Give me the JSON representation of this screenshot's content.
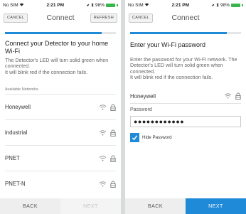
{
  "left": {
    "status": {
      "carrier": "No SIM",
      "time": "2:21 PM",
      "battery": "98%"
    },
    "nav": {
      "cancel": "CANCEL",
      "title": "Connect",
      "refresh": "REFRESH"
    },
    "progress_fraction": 0.87,
    "heading": "Connect your Detector to your home Wi-Fi",
    "body": "The Detector's LED will turn solid green when connected.\nIt will blink red if the connection fails.",
    "section_label": "Available Networks",
    "networks": [
      {
        "name": "Honeywell"
      },
      {
        "name": "industrial"
      },
      {
        "name": "PNET"
      },
      {
        "name": "PNET-N"
      }
    ],
    "back": "BACK",
    "next": "NEXT"
  },
  "right": {
    "status": {
      "carrier": "No SIM",
      "time": "2:21 PM",
      "battery": "98%"
    },
    "nav": {
      "cancel": "CANCEL",
      "title": "Connect"
    },
    "progress_fraction": 0.87,
    "heading": "Enter your Wi-Fi password",
    "body": "Enter the password for your Wi-Fi network. The Detector's LED will turn solid green when connected.\nIt will blink red if the connection fails.",
    "network_name": "Honeywell",
    "password_label": "Password",
    "password_value": "●●●●●●●●●●●●",
    "hide_password_label": "Hide Password",
    "hide_password_checked": true,
    "back": "BACK",
    "next": "NEXT"
  },
  "colors": {
    "accent": "#1f8ad8",
    "battery": "#3ab54a"
  },
  "icons": [
    "wifi-signal-icon",
    "bluetooth-icon",
    "location-arrow-icon",
    "wifi-icon",
    "lock-icon",
    "checkmark-icon"
  ]
}
